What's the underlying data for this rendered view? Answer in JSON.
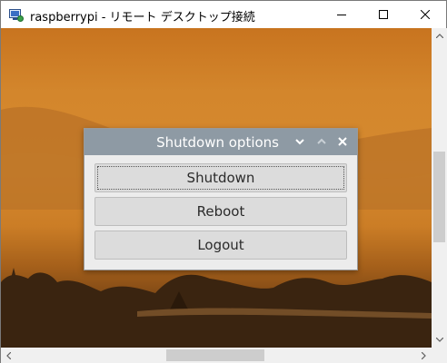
{
  "window": {
    "title": "raspberrypi - リモート デスクトップ接続",
    "app_icon": "remote-desktop-icon",
    "controls": [
      "minimize-icon",
      "maximize-icon",
      "close-icon"
    ]
  },
  "dialog": {
    "title": "Shutdown options",
    "title_controls": [
      "chevron-down-icon",
      "chevron-up-icon",
      "close-icon"
    ],
    "options": [
      {
        "label": "Shutdown",
        "focused": true
      },
      {
        "label": "Reboot",
        "focused": false
      },
      {
        "label": "Logout",
        "focused": false
      }
    ]
  },
  "colors": {
    "dialog_titlebar": "#8e9aa4",
    "dialog_bg": "#ececec",
    "button_bg": "#dcdcdc",
    "desktop_accent": "#d68a2f"
  }
}
